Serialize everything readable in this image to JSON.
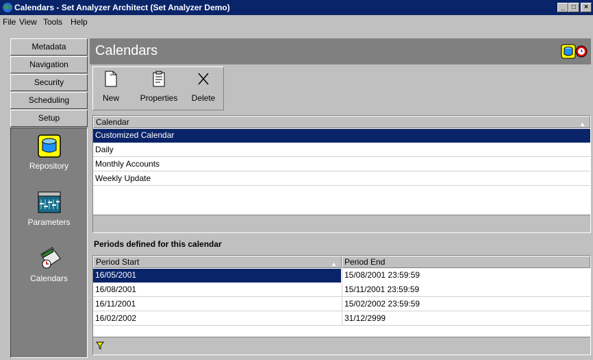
{
  "window": {
    "title": "Calendars - Set Analyzer Architect (Set Analyzer Demo)",
    "controls": [
      "minimize",
      "maximize",
      "close"
    ]
  },
  "menu": {
    "file": "File",
    "view": "View",
    "tools": "Tools",
    "help": "Help"
  },
  "nav": {
    "metadata": "Metadata",
    "navigation": "Navigation",
    "security": "Security",
    "scheduling": "Scheduling",
    "setup": "Setup"
  },
  "setup_items": {
    "repository": "Repository",
    "parameters": "Parameters",
    "calendars": "Calendars"
  },
  "header": {
    "title": "Calendars"
  },
  "toolbar": {
    "new": "New",
    "properties": "Properties",
    "delete": "Delete"
  },
  "calendar_grid": {
    "column": "Calendar",
    "rows": [
      "Customized Calendar",
      "Daily",
      "Monthly Accounts",
      "Weekly Update"
    ],
    "selected_index": 0
  },
  "periods": {
    "label": "Periods defined for this calendar",
    "columns": [
      "Period Start",
      "Period End"
    ],
    "rows": [
      [
        "16/05/2001",
        "15/08/2001 23:59:59"
      ],
      [
        "16/08/2001",
        "15/11/2001 23:59:59"
      ],
      [
        "16/11/2001",
        "15/02/2002 23:59:59"
      ],
      [
        "16/02/2002",
        "31/12/2999"
      ]
    ],
    "selected_index": 0
  },
  "colors": {
    "selection": "#0a246a",
    "panel_gray": "#808080",
    "face": "#c0c0c0"
  }
}
